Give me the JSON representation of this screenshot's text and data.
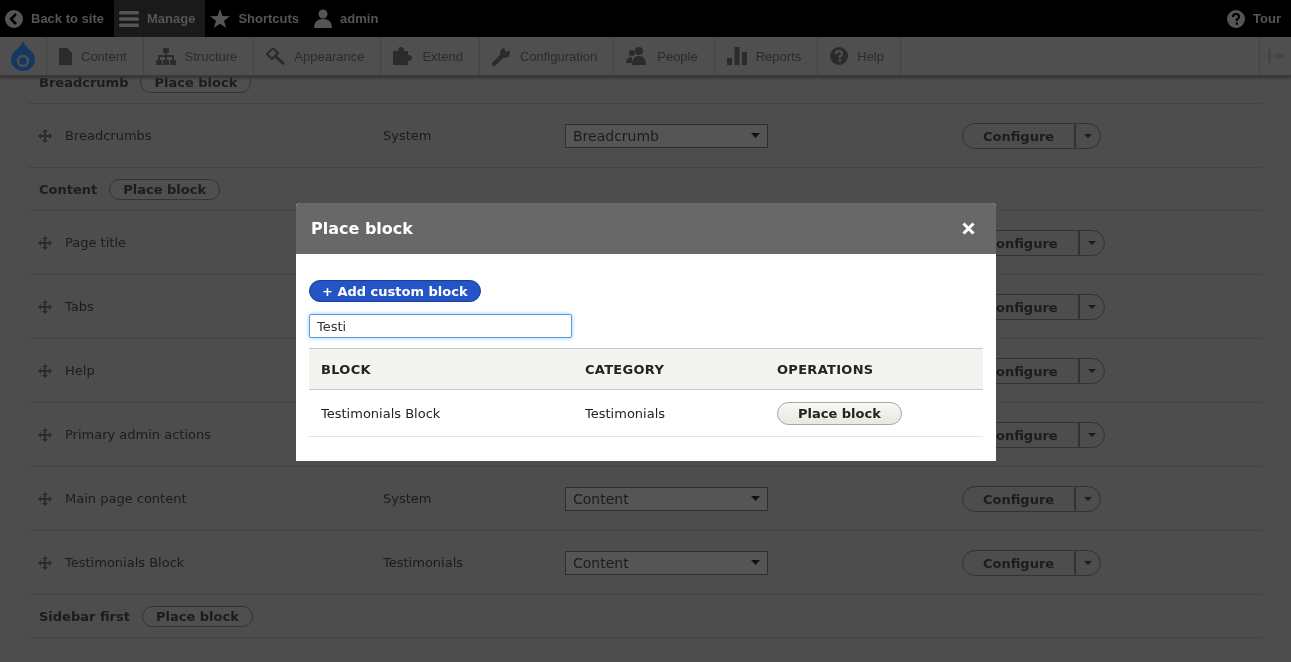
{
  "toolbar": {
    "items": [
      {
        "label": "Back to site",
        "selected": false
      },
      {
        "label": "Manage",
        "selected": true
      },
      {
        "label": "Shortcuts",
        "selected": false
      },
      {
        "label": "admin",
        "selected": false
      }
    ],
    "tour": "Tour"
  },
  "admin_menu": {
    "items": [
      {
        "label": "Content"
      },
      {
        "label": "Structure"
      },
      {
        "label": "Appearance"
      },
      {
        "label": "Extend"
      },
      {
        "label": "Configuration"
      },
      {
        "label": "People"
      },
      {
        "label": "Reports"
      },
      {
        "label": "Help"
      }
    ]
  },
  "regions": [
    {
      "name": "Breadcrumb",
      "button": "Place block",
      "blocks": [
        {
          "name": "Breadcrumbs",
          "covered": false,
          "category": "System",
          "region": "Breadcrumb",
          "operation": "Configure"
        }
      ]
    },
    {
      "name": "Content",
      "button": "Place block",
      "blocks": [
        {
          "name": "Page title",
          "covered": true,
          "operation": "onfigure"
        },
        {
          "name": "Tabs",
          "covered": true,
          "operation": "onfigure"
        },
        {
          "name": "Help",
          "covered": true,
          "operation": "onfigure"
        },
        {
          "name": "Primary admin actions",
          "covered": true,
          "operation": "onfigure"
        },
        {
          "name": "Main page content",
          "covered": false,
          "category": "System",
          "region": "Content",
          "operation": "Configure"
        },
        {
          "name": "Testimonials Block",
          "covered": false,
          "category": "Testimonials",
          "region": "Content",
          "operation": "Configure"
        }
      ]
    },
    {
      "name": "Sidebar first",
      "button": "Place block"
    }
  ],
  "modal": {
    "title": "Place block",
    "add_button": "+ Add custom block",
    "filter": {
      "value": "Testi"
    },
    "table": {
      "columns": [
        "BLOCK",
        "CATEGORY",
        "OPERATIONS"
      ],
      "rows": [
        {
          "block": "Testimonials Block",
          "category": "Testimonials",
          "operation": "Place block"
        }
      ]
    }
  }
}
